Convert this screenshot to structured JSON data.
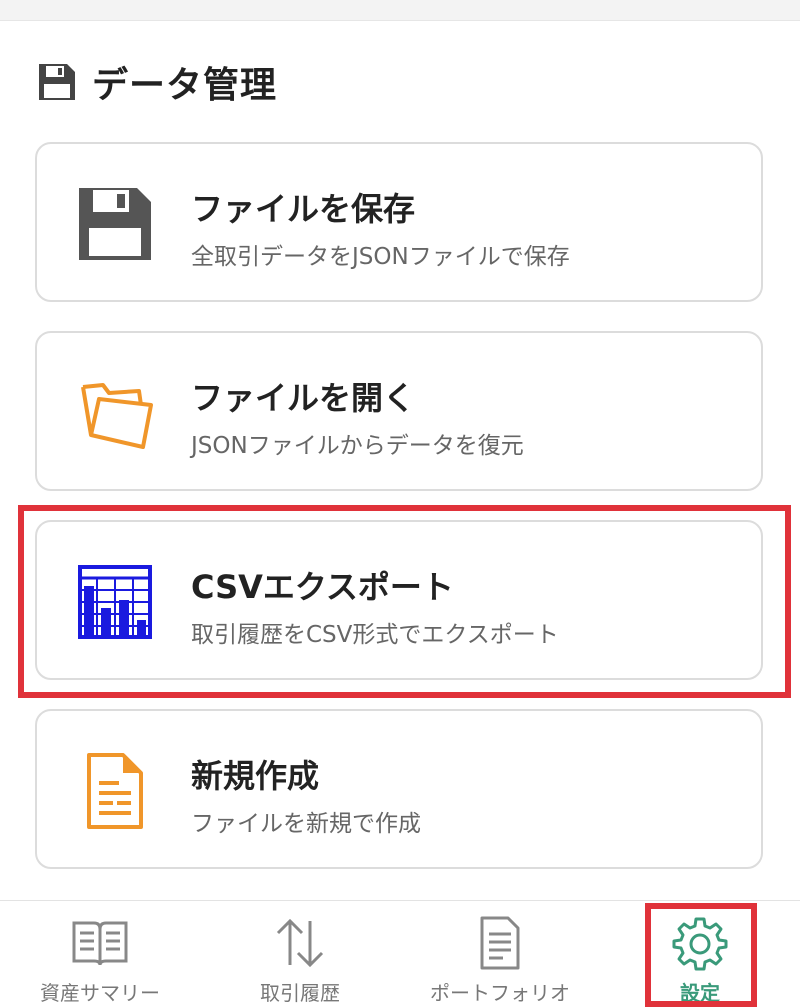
{
  "header": {
    "title": "データ管理",
    "icon": "floppy-disk-icon"
  },
  "actions": [
    {
      "id": "save",
      "title": "ファイルを保存",
      "description": "全取引データをJSONファイルで保存",
      "icon": "floppy-disk-icon",
      "icon_color": "#555555"
    },
    {
      "id": "open",
      "title": "ファイルを開く",
      "description": "JSONファイルからデータを復元",
      "icon": "open-folder-icon",
      "icon_color": "#f0962a"
    },
    {
      "id": "csv",
      "title": "CSVエクスポート",
      "description": "取引履歴をCSV形式でエクスポート",
      "icon": "bar-chart-table-icon",
      "icon_color": "#1a1adf"
    },
    {
      "id": "new",
      "title": "新規作成",
      "description": "ファイルを新規で作成",
      "icon": "document-icon",
      "icon_color": "#f0962a"
    }
  ],
  "bottom_nav": {
    "items": [
      {
        "label": "資産サマリー",
        "icon": "book-icon"
      },
      {
        "label": "取引履歴",
        "icon": "up-down-arrows-icon"
      },
      {
        "label": "ポートフォリオ",
        "icon": "document-icon"
      },
      {
        "label": "設定",
        "icon": "gear-icon",
        "active": true
      }
    ]
  },
  "colors": {
    "highlight": "#e0323a",
    "active_nav": "#3a9a7a",
    "card_border": "#dcdcdc"
  }
}
